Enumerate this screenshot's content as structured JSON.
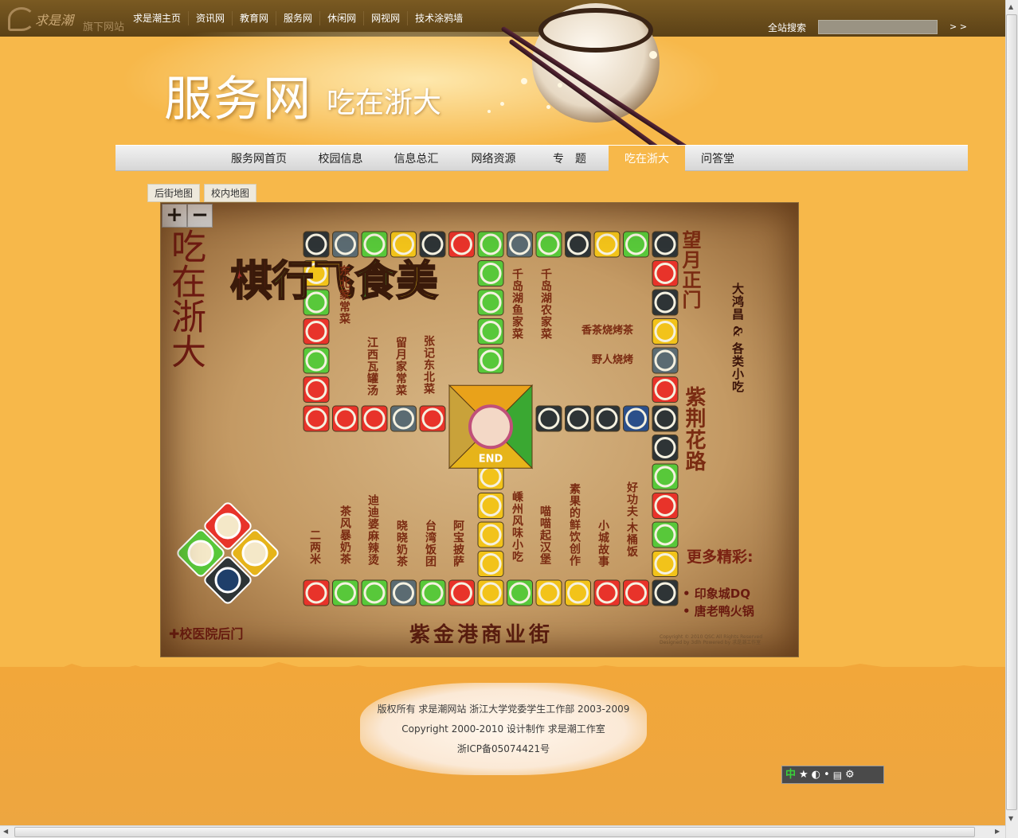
{
  "topbar": {
    "logo_text": "求是潮",
    "logo_subtitle": "旗下网站",
    "nav": [
      "求是潮主页",
      "资讯网",
      "教育网",
      "服务网",
      "休闲网",
      "网视网",
      "技术涂鸦墙"
    ],
    "search_label": "全站搜索",
    "search_value": "",
    "search_go": "> >"
  },
  "header": {
    "title": "服务网",
    "subtitle": "吃在浙大"
  },
  "mainnav": {
    "items": [
      "服务网首页",
      "校园信息",
      "信息总汇",
      "网络资源",
      "专　题",
      "吃在浙大",
      "问答堂"
    ],
    "active": "吃在浙大"
  },
  "map_tabs": [
    "后街地图",
    "校内地图"
  ],
  "zoom": {
    "in": "+",
    "out": "−"
  },
  "map": {
    "left_title": "吃在浙大",
    "game_title": [
      "美",
      "食",
      "飞",
      "行",
      "棋"
    ],
    "end_label": "END",
    "places": {
      "top_left_a": "东北家常菜",
      "top_mid_a": "江西瓦罐汤",
      "top_mid_b": "留月家常菜",
      "top_mid_c": "张记东北菜",
      "top_center_a": "千岛湖鱼家菜",
      "top_center_b": "千岛湖农家菜",
      "top_right_a": "香茶烧烤茶",
      "top_right_b": "野人烧烤",
      "right_top": "望月正门",
      "right_far": "大鸿昌 & 各类小吃",
      "right_mid": "紫荆花路",
      "bottom_1": "二两米",
      "bottom_2": "茶风暴奶茶",
      "bottom_3": "迪迪婆麻辣烫",
      "bottom_4": "晓晓奶茶",
      "bottom_5": "台湾饭团",
      "bottom_6": "阿宝披萨",
      "bottom_7": "嵊州风味小吃",
      "bottom_8": "喵喵起汉堡",
      "bottom_9": "素果的鲜饮创作",
      "bottom_10": "小城故事",
      "bottom_11": "好功夫·木桶饭"
    },
    "more_title": "更多精彩:",
    "more_items": [
      "• 印象城DQ",
      "• 唐老鸭火锅"
    ],
    "bottom_street": "紫金港商业街",
    "hospital": "✚校医院后门",
    "copyright_small": "Copyright © 2010 QSC All Rights Reserved Designed by 3dlh Powered by 求是潮工作室"
  },
  "footer": {
    "line1": "版权所有 求是潮网站 浙江大学党委学生工作部 2003-2009",
    "line2": "Copyright 2000-2010 设计制作 求是潮工作室",
    "line3": "浙ICP备05074421号"
  },
  "ime": {
    "lang": "中",
    "icons": [
      "star-icon",
      "moon-icon",
      "dots-icon",
      "keyboard-icon",
      "gear-icon"
    ]
  },
  "colors": {
    "background": "#f7b84a",
    "topbar": "#5b4116",
    "map_text": "#7a2b12",
    "cell_black": "#2e3436",
    "cell_red": "#e8332a",
    "cell_green": "#58c83a",
    "cell_yellow": "#f2c31a",
    "cell_gray": "#5b6b72"
  },
  "board": {
    "top_row": [
      "black",
      "gray",
      "green",
      "yellow",
      "black",
      "red",
      "green",
      "gray",
      "green",
      "black",
      "yellow",
      "green",
      "black"
    ],
    "left_col": [
      "yellow",
      "green",
      "red",
      "green",
      "red"
    ],
    "left_arm": [
      "red",
      "red",
      "red",
      "gray",
      "red"
    ],
    "right_arm": [
      "black",
      "black",
      "black",
      "blue",
      "black"
    ],
    "right_col_top": [
      "red",
      "black",
      "yellow",
      "gray",
      "red"
    ],
    "right_col_bottom": [
      "black",
      "green",
      "red",
      "green",
      "yellow"
    ],
    "center_up": [
      "green",
      "green",
      "green",
      "green"
    ],
    "center_down": [
      "yellow",
      "yellow",
      "yellow",
      "yellow"
    ],
    "bottom_row": [
      "red",
      "green",
      "green",
      "gray",
      "green",
      "red",
      "yellow",
      "green",
      "yellow",
      "yellow",
      "red",
      "red",
      "black"
    ]
  }
}
